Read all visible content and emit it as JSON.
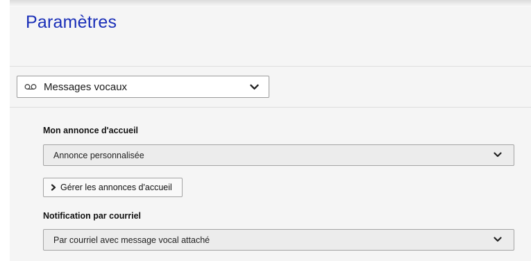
{
  "page": {
    "title": "Paramètres"
  },
  "section_select": {
    "icon": "voicemail-icon",
    "value": "Messages vocaux"
  },
  "greeting": {
    "label": "Mon annonce d'accueil",
    "value": "Annonce personnalisée",
    "manage_button": "Gérer les annonces d'accueil"
  },
  "notification": {
    "label": "Notification par courriel",
    "value": "Par courriel avec message vocal attaché"
  },
  "colors": {
    "title": "#1a2fb8",
    "panel": "#f5f5f5",
    "field": "#ececec"
  }
}
